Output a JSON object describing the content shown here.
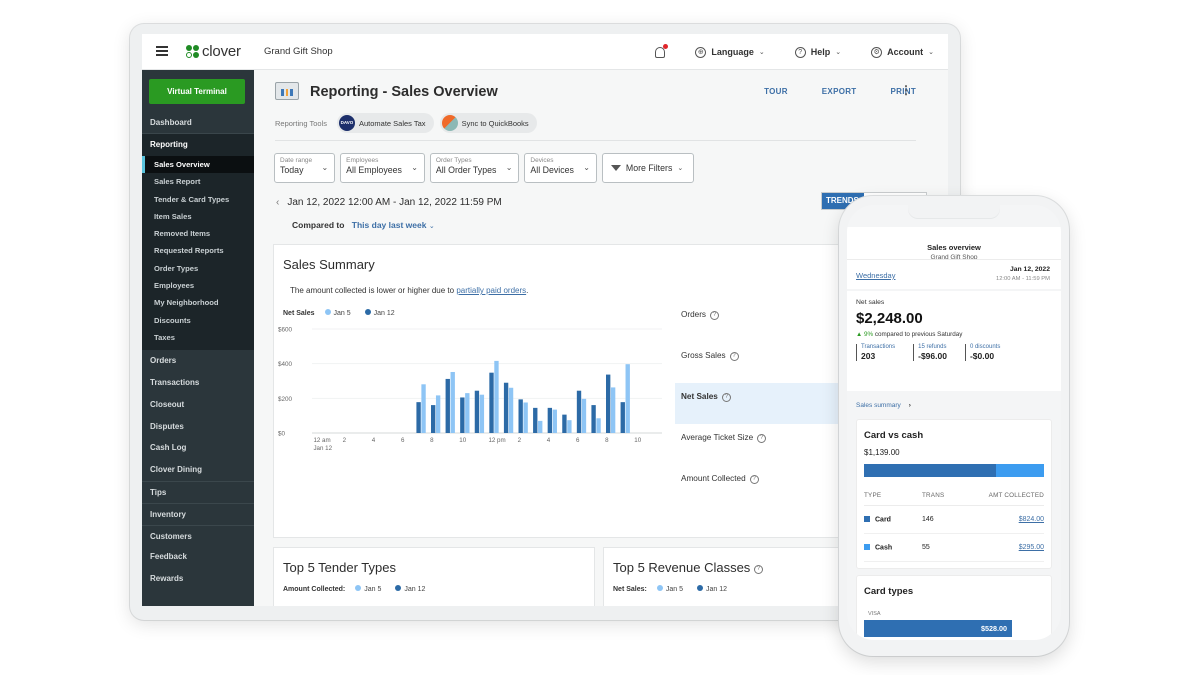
{
  "app": {
    "logo_text": "clover",
    "shop_name": "Grand Gift Shop",
    "top_nav": {
      "language": "Language",
      "help": "Help",
      "account": "Account"
    }
  },
  "sidebar": {
    "virtual_terminal": "Virtual Terminal",
    "dashboard": "Dashboard",
    "reporting": {
      "label": "Reporting",
      "items": [
        {
          "label": "Sales Overview",
          "active": true
        },
        {
          "label": "Sales Report"
        },
        {
          "label": "Tender & Card Types"
        },
        {
          "label": "Item Sales"
        },
        {
          "label": "Removed Items"
        },
        {
          "label": "Requested Reports"
        },
        {
          "label": "Order Types"
        },
        {
          "label": "Employees"
        },
        {
          "label": "My Neighborhood"
        },
        {
          "label": "Discounts"
        },
        {
          "label": "Taxes"
        }
      ]
    },
    "group1": [
      "Orders",
      "Transactions",
      "Closeout",
      "Disputes",
      "Cash Log",
      "Clover Dining"
    ],
    "group2": [
      "Tips"
    ],
    "group3": [
      "Inventory"
    ],
    "group4": [
      "Customers",
      "Feedback",
      "Rewards"
    ]
  },
  "page": {
    "title": "Reporting - Sales Overview",
    "actions": {
      "tour": "TOUR",
      "export": "EXPORT",
      "print": "PRINT"
    },
    "tools_label": "Reporting Tools",
    "tools": [
      {
        "icon_text": "DAVO",
        "label": "Automate Sales Tax"
      },
      {
        "label": "Sync to QuickBooks"
      }
    ],
    "filters": [
      {
        "label": "Date range",
        "value": "Today"
      },
      {
        "label": "Employees",
        "value": "All Employees"
      },
      {
        "label": "Order Types",
        "value": "All Order Types"
      },
      {
        "label": "Devices",
        "value": "All Devices"
      }
    ],
    "more_filters": "More Filters",
    "date_range": "Jan 12, 2022 12:00 AM - Jan 12, 2022 11:59 PM",
    "compared_label": "Compared to",
    "compared_value": "This day last week",
    "trends_label": "TRENDS"
  },
  "summary": {
    "title": "Sales Summary",
    "note_prefix": "The amount collected is lower or higher due to ",
    "note_link": "partially paid orders",
    "note_suffix": ".",
    "legend_title": "Net Sales",
    "metrics": [
      {
        "label": "Orders",
        "active": false,
        "caret": false
      },
      {
        "label": "Gross Sales",
        "active": false,
        "caret": true
      },
      {
        "label": "Net Sales",
        "active": true,
        "caret": true
      },
      {
        "label": "Average Ticket Size",
        "active": false,
        "caret": false
      },
      {
        "label": "Amount Collected",
        "active": false,
        "caret": true
      }
    ]
  },
  "chart_data": {
    "type": "bar",
    "title": "Net Sales",
    "xlabel": "",
    "ylabel": "",
    "ylim": [
      0,
      600
    ],
    "yticks": [
      "$0",
      "$200",
      "$400",
      "$600"
    ],
    "ytick_values": [
      0,
      200,
      400,
      600
    ],
    "xtick_labels": [
      "12 am",
      "2",
      "4",
      "6",
      "8",
      "10",
      "12 pm",
      "2",
      "4",
      "6",
      "8",
      "10"
    ],
    "xtick_sublabel": "Jan 12",
    "categories": [
      "12am",
      "1am",
      "2am",
      "3am",
      "4am",
      "5am",
      "6am",
      "7am",
      "8am",
      "9am",
      "10am",
      "11am",
      "12pm",
      "1pm",
      "2pm",
      "3pm",
      "4pm",
      "5pm",
      "6pm",
      "7pm",
      "8pm",
      "9pm",
      "10pm",
      "11pm"
    ],
    "series": [
      {
        "name": "Jan 5",
        "color": "#8ec5f5",
        "values": [
          0,
          0,
          0,
          0,
          0,
          0,
          0,
          281,
          217,
          352,
          230,
          221,
          416,
          261,
          176,
          70,
          135,
          74,
          197,
          85,
          263,
          397,
          0,
          0
        ]
      },
      {
        "name": "Jan 12",
        "color": "#2c6aa6",
        "values": [
          0,
          0,
          0,
          0,
          0,
          0,
          0,
          178,
          161,
          312,
          205,
          244,
          348,
          290,
          194,
          145,
          145,
          106,
          244,
          161,
          337,
          178,
          0,
          0
        ]
      }
    ],
    "grid": true,
    "legend": "top-left"
  },
  "top5": {
    "tender": {
      "title": "Top 5 Tender Types",
      "legend_title": "Amount Collected:"
    },
    "revenue": {
      "title": "Top 5 Revenue Classes",
      "legend_title": "Net Sales:"
    },
    "legend": [
      "Jan 5",
      "Jan 12"
    ]
  },
  "phone": {
    "title": "Sales overview",
    "shop": "Grand Gift Shop",
    "day": "Wednesday",
    "date": "Jan 12, 2022",
    "time_range": "12:00 AM - 11:59 PM",
    "net_sales_label": "Net sales",
    "net_sales_value": "$2,248.00",
    "change_pct": "9%",
    "change_text": " compared to previous Saturday",
    "stats": [
      {
        "label": "Transactions",
        "value": "203"
      },
      {
        "label": "15 refunds",
        "value": "-$96.00"
      },
      {
        "label": "0 discounts",
        "value": "-$0.00"
      }
    ],
    "summary_link": "Sales summary",
    "card_vs_cash": {
      "title": "Card vs cash",
      "total": "$1,139.00",
      "card_fraction": 0.736,
      "headers": [
        "TYPE",
        "TRANS",
        "AMT COLLECTED"
      ],
      "rows": [
        {
          "type": "Card",
          "trans": "146",
          "amount": "$824.00",
          "color": "#2f6fb2"
        },
        {
          "type": "Cash",
          "trans": "55",
          "amount": "$295.00",
          "color": "#3c9cf0"
        }
      ]
    },
    "card_types": {
      "title": "Card types",
      "visa_label": "VISA",
      "visa_amount": "$528.00"
    }
  }
}
